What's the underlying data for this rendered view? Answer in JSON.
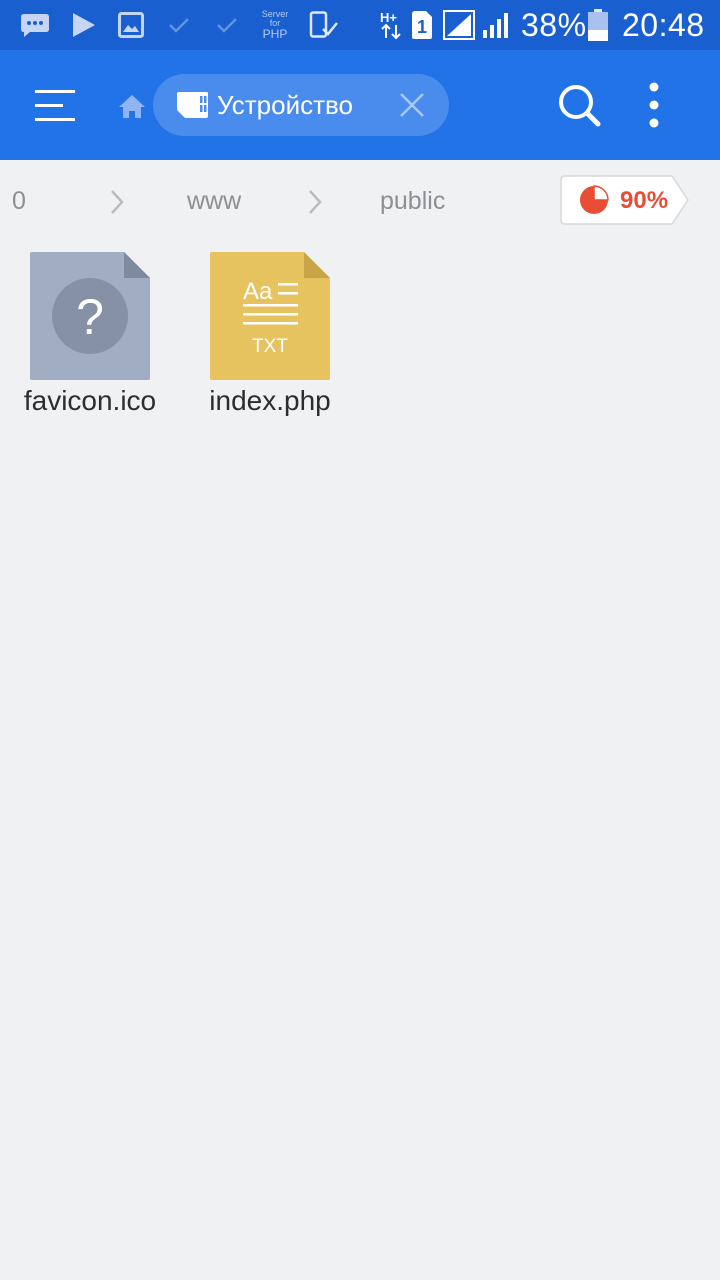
{
  "status_bar": {
    "battery": "38%",
    "time": "20:48",
    "server_app": {
      "line1": "Server",
      "line2": "for",
      "line3": "PHP"
    },
    "network": "H+",
    "sim_slot": "1",
    "icons": [
      "messages-icon",
      "play-icon",
      "image-icon",
      "check-icon",
      "check-icon",
      "server-for-php-icon",
      "device-check-icon",
      "data-arrows-icon",
      "sim-1-icon",
      "signal-icon",
      "signal-icon",
      "battery-icon"
    ]
  },
  "app_bar": {
    "location_label": "Устройство",
    "icons": [
      "menu-icon",
      "home-icon",
      "sd-card-icon",
      "close-icon",
      "search-icon",
      "more-vert-icon"
    ]
  },
  "breadcrumb": {
    "items": [
      "0",
      "www",
      "public"
    ],
    "storage_usage": "90%"
  },
  "colors": {
    "status_bar": "#1a5fcf",
    "app_bar": "#2272e8",
    "chip": "#4a8cee",
    "background": "#eff1f3",
    "accent_red": "#e94d36",
    "unknown_file": "#a1adc3",
    "txt_file": "#e7c35f"
  },
  "files": [
    {
      "name": "favicon.ico",
      "icon": "unknown-file-icon",
      "glyph": "?"
    },
    {
      "name": "index.php",
      "icon": "txt-file-icon",
      "glyph": "Aa",
      "type_label": "TXT"
    }
  ]
}
